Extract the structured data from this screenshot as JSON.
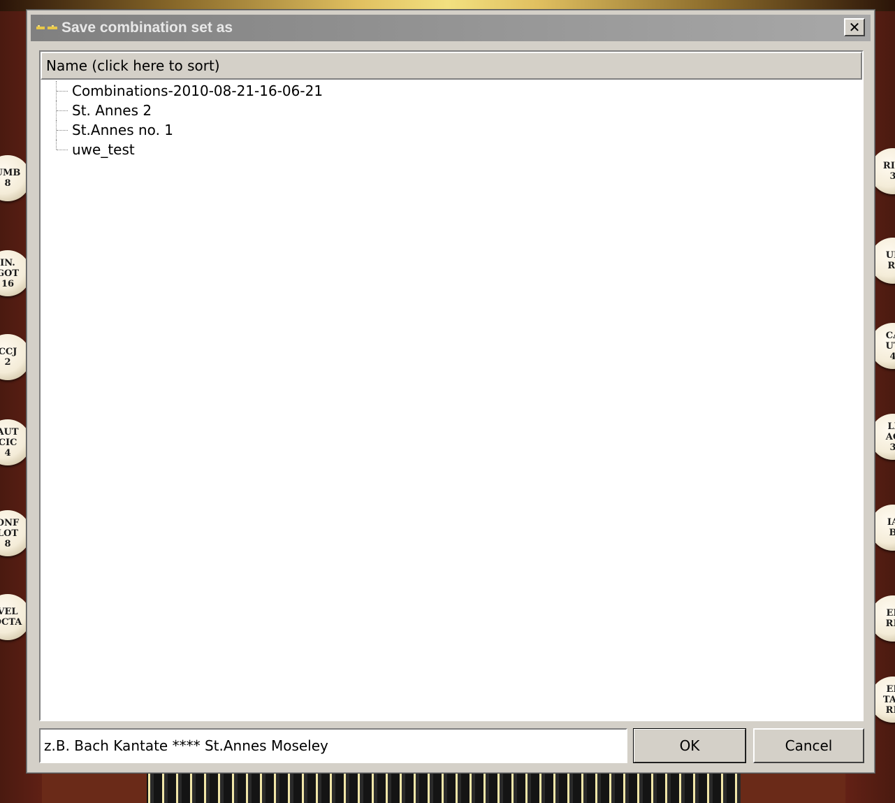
{
  "background": {
    "left_stops": [
      [
        "UMB",
        "8"
      ],
      [
        "IN.",
        "GOT",
        "16"
      ],
      [
        "CCJ",
        "2"
      ],
      [
        "AUT",
        "CIC",
        "4"
      ],
      [
        "ONF",
        "LOT",
        "8"
      ],
      [
        "VEL",
        "OCTA"
      ]
    ],
    "right_stops": [
      [
        "RIO",
        "3"
      ],
      [
        "UF",
        "R."
      ],
      [
        "CA",
        "UT",
        "4"
      ],
      [
        "LI",
        "AC",
        "3"
      ],
      [
        "IA",
        "B"
      ],
      [
        "EL",
        "RE"
      ],
      [
        "EL",
        "TAV",
        "RE"
      ]
    ]
  },
  "dialog": {
    "title": "Save combination set as",
    "close_label": "✕",
    "column_header": "Name (click here to sort)",
    "items": [
      {
        "label": "Combinations-2010-08-21-16-06-21"
      },
      {
        "label": "St. Annes 2"
      },
      {
        "label": "St.Annes no. 1"
      },
      {
        "label": "uwe_test"
      }
    ],
    "name_value": "z.B. Bach Kantate **** St.Annes Moseley",
    "ok_label": "OK",
    "cancel_label": "Cancel"
  },
  "colors": {
    "titlebar_start": "#808080",
    "titlebar_end": "#a8a8a8",
    "dialog_face": "#d4d0c8"
  }
}
